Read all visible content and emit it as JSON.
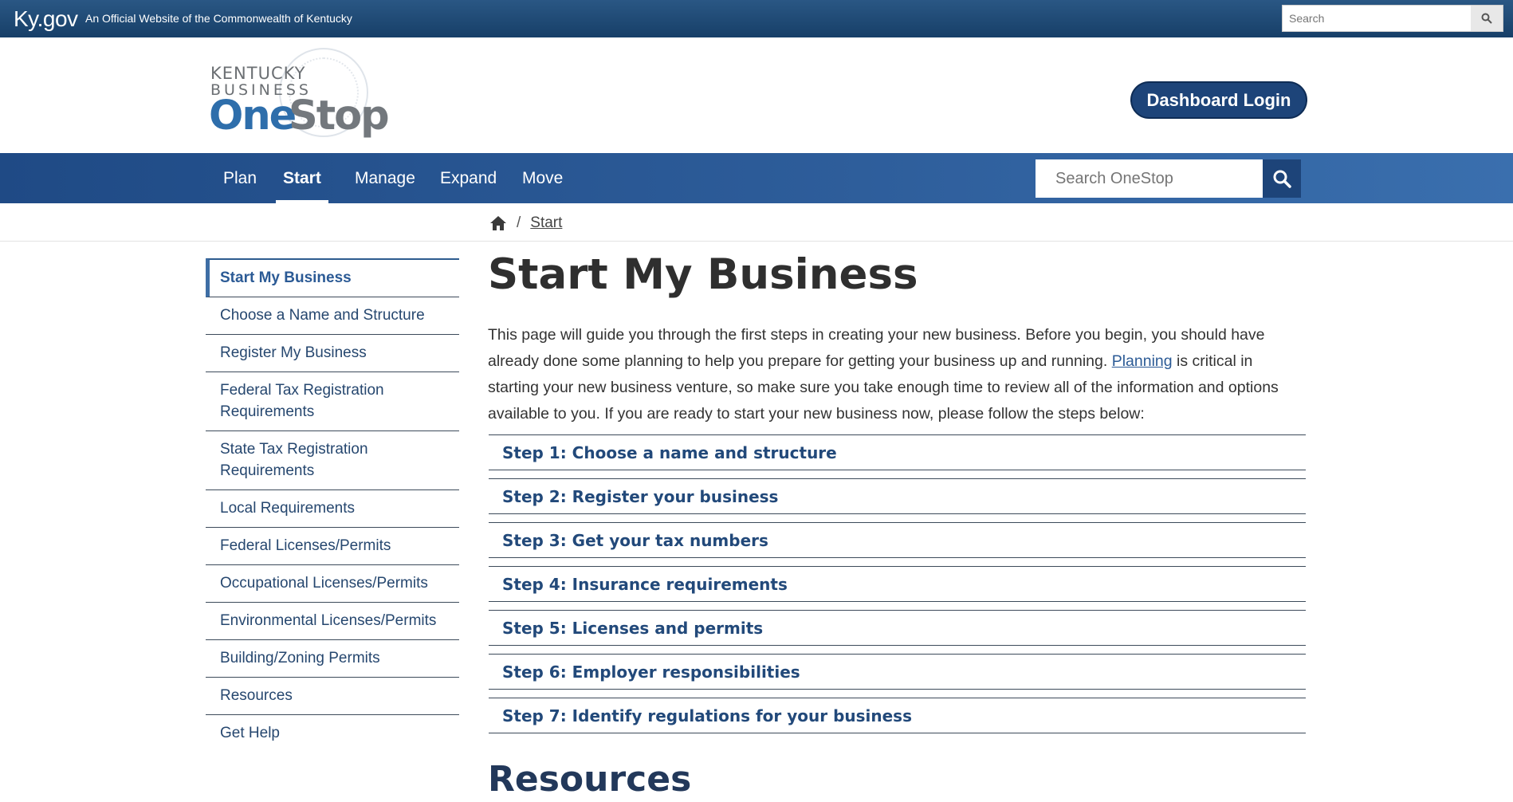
{
  "kygov": {
    "logo": "Ky.gov",
    "tagline": "An Official Website of the Commonwealth of Kentucky",
    "search_placeholder": "Search"
  },
  "header": {
    "logo_line1": "KENTUCKY",
    "logo_line2": "BUSINESS",
    "logo_one": "One",
    "logo_stop": "Stop",
    "dashboard_login": "Dashboard Login"
  },
  "nav": {
    "items": [
      {
        "label": "Plan",
        "active": false
      },
      {
        "label": "Start",
        "active": true
      },
      {
        "label": "Manage",
        "active": false
      },
      {
        "label": "Expand",
        "active": false
      },
      {
        "label": "Move",
        "active": false
      }
    ],
    "search_placeholder": "Search OneStop"
  },
  "breadcrumb": {
    "separator": "/",
    "current": "Start"
  },
  "sidebar": {
    "items": [
      {
        "label": "Start My Business",
        "active": true
      },
      {
        "label": "Choose a Name and Structure"
      },
      {
        "label": "Register My Business"
      },
      {
        "label": "Federal Tax Registration Requirements"
      },
      {
        "label": "State Tax Registration Requirements"
      },
      {
        "label": "Local Requirements"
      },
      {
        "label": "Federal Licenses/Permits"
      },
      {
        "label": "Occupational Licenses/Permits"
      },
      {
        "label": "Environmental Licenses/Permits"
      },
      {
        "label": "Building/Zoning Permits"
      },
      {
        "label": "Resources"
      },
      {
        "label": "Get Help"
      }
    ]
  },
  "main": {
    "title": "Start My Business",
    "intro_part1": "This page will guide you through the first steps in creating your new business. Before you begin, you should have already done some planning to help you prepare for getting your business up and running. ",
    "intro_link": "Planning",
    "intro_part2": " is critical in starting your new business venture, so make sure you take enough time to review all of the information and options available to you. If you are ready to start your new business now, please follow the steps below:",
    "steps": [
      "Step 1: Choose a name and structure",
      "Step 2: Register your business",
      "Step 3: Get your tax numbers",
      "Step 4: Insurance requirements",
      "Step 5: Licenses and permits",
      "Step 6: Employer responsibilities",
      "Step 7: Identify regulations for your business"
    ],
    "resources_heading": "Resources"
  },
  "colors": {
    "kybar": "#1f4a78",
    "nav": "#2c5b98",
    "accent": "#1d4479",
    "link": "#2b5a95"
  }
}
